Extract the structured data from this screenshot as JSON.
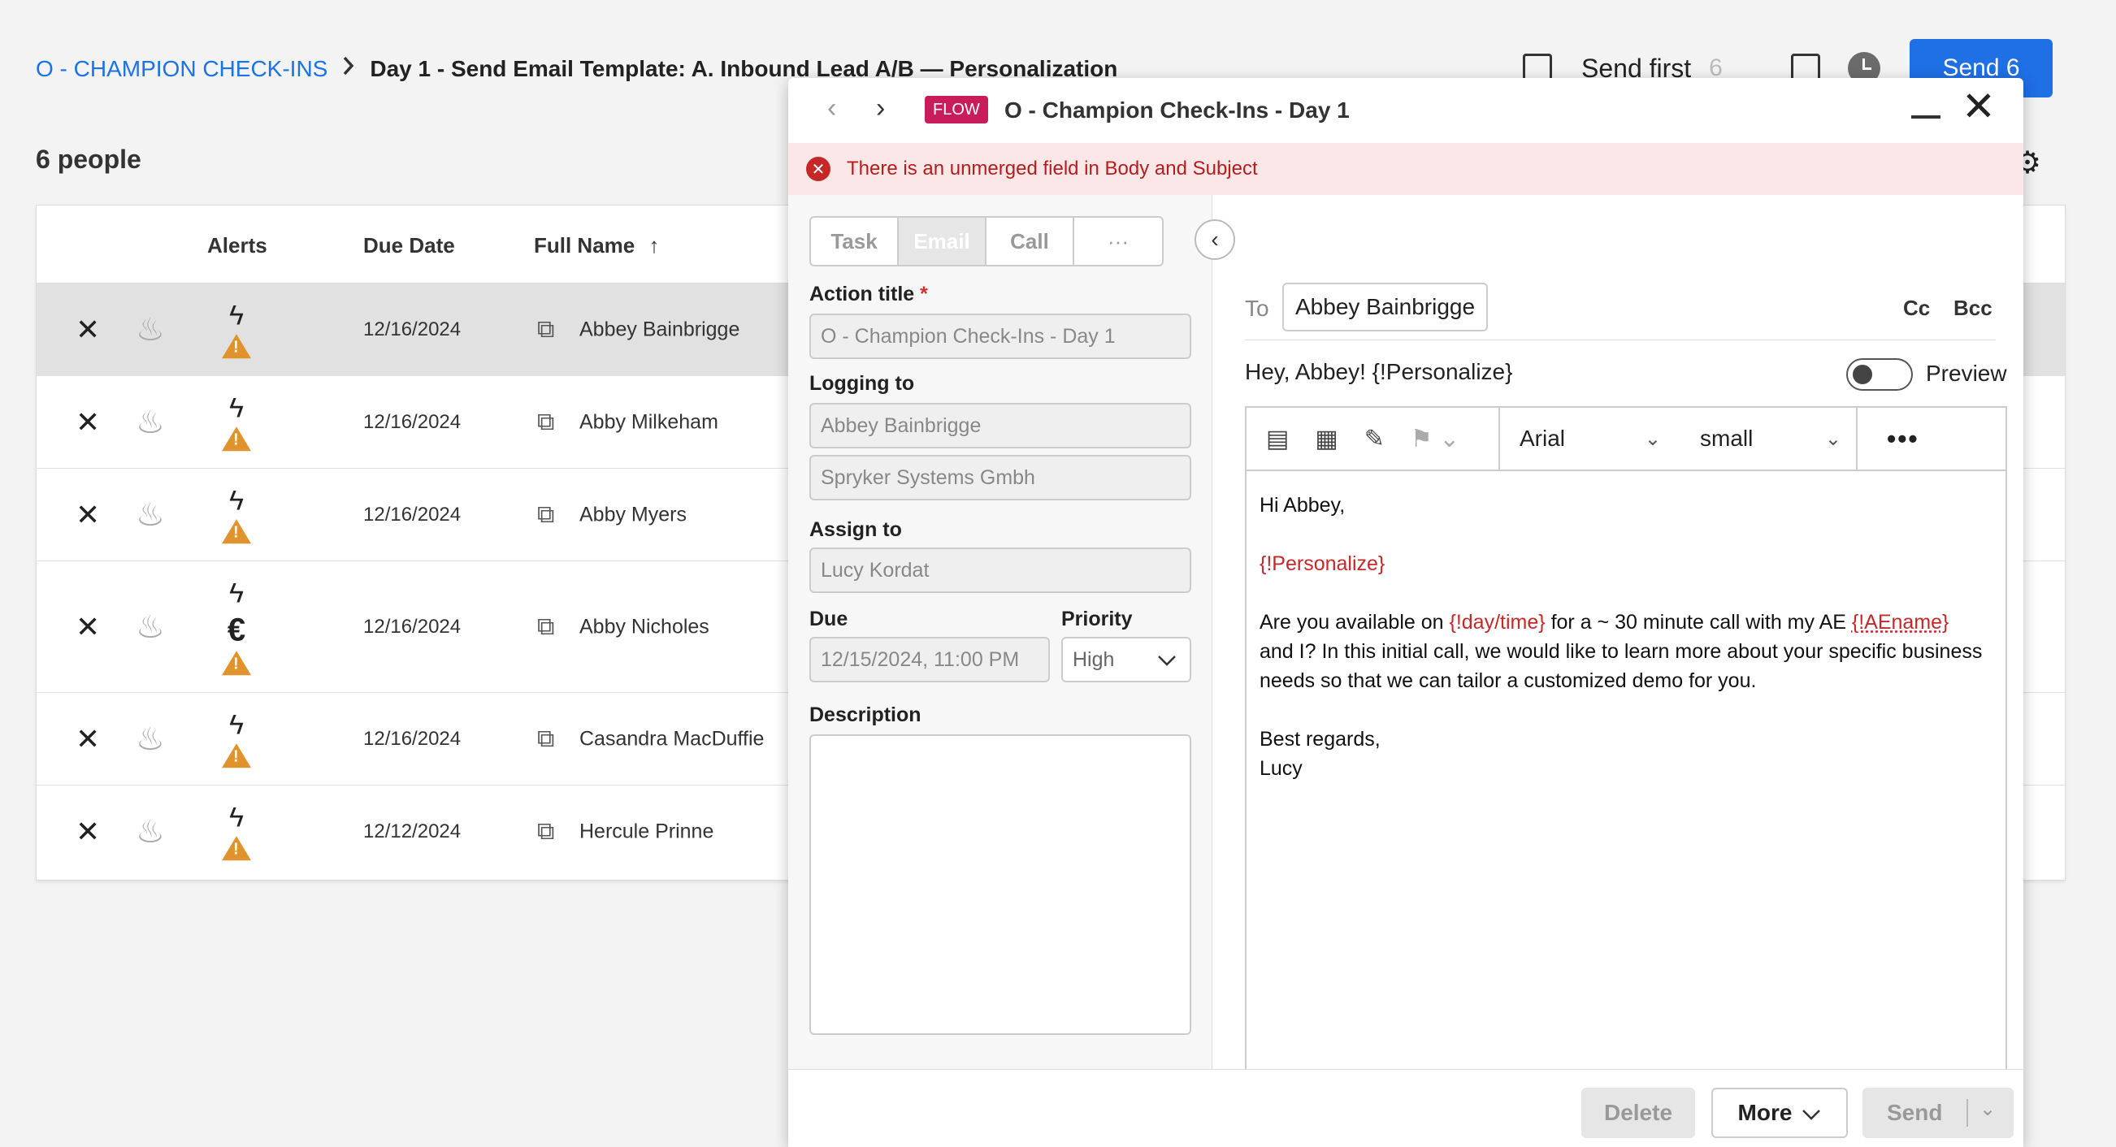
{
  "breadcrumb": {
    "parent": "O - CHAMPION CHECK-INS",
    "current": "Day 1 - Send Email Template: A. Inbound Lead A/B — Personalization"
  },
  "top_actions": {
    "send_first_label": "Send first",
    "send_first_count": "6",
    "send_button": "Send 6"
  },
  "people_count": "6 people",
  "table": {
    "headers": {
      "alerts": "Alerts",
      "due_date": "Due Date",
      "full_name": "Full Name"
    },
    "rows": [
      {
        "due": "12/16/2024",
        "name": "Abbey Bainbrigge",
        "selected": true
      },
      {
        "due": "12/16/2024",
        "name": "Abby Milkeham"
      },
      {
        "due": "12/16/2024",
        "name": "Abby Myers"
      },
      {
        "due": "12/16/2024",
        "name": "Abby Nicholes",
        "extra_alert": "€"
      },
      {
        "due": "12/16/2024",
        "name": "Casandra MacDuffie"
      },
      {
        "due": "12/12/2024",
        "name": "Hercule Prinne"
      }
    ]
  },
  "modal": {
    "badge": "FLOW",
    "title": "O - Champion Check-Ins - Day 1",
    "error": "There is an unmerged field in Body and Subject",
    "tabs": [
      "Task",
      "Email",
      "Call",
      "···"
    ],
    "action_title_label": "Action title",
    "action_title_required": "*",
    "action_title_value": "O - Champion Check-Ins - Day 1",
    "logging_label": "Logging to",
    "logging_person": "Abbey Bainbrigge",
    "logging_company": "Spryker Systems Gmbh",
    "assign_label": "Assign to",
    "assign_value": "Lucy Kordat",
    "due_label": "Due",
    "due_value": "12/15/2024, 11:00 PM",
    "priority_label": "Priority",
    "priority_value": "High",
    "description_label": "Description",
    "description_value": "",
    "email": {
      "to_label": "To",
      "to_value": "Abbey Bainbrigge",
      "cc": "Cc",
      "bcc": "Bcc",
      "subject": "Hey, Abbey! {!Personalize}",
      "preview_label": "Preview",
      "font_family": "Arial",
      "font_size": "small",
      "body": {
        "greeting": "Hi Abbey,",
        "personalize": "{!Personalize}",
        "p1_a": "Are you available on ",
        "p1_daytime": "{!day/time}",
        "p1_b": " for a ~ 30 minute call with my AE ",
        "p1_aename": "{!AEname}",
        "p1_c": "and I? In this initial call, we would like to learn more about your specific business needs so that we can tailor a customized demo for you.",
        "closing": "Best regards,",
        "signature": "Lucy"
      }
    },
    "footer": {
      "delete": "Delete",
      "more": "More",
      "send": "Send"
    }
  }
}
